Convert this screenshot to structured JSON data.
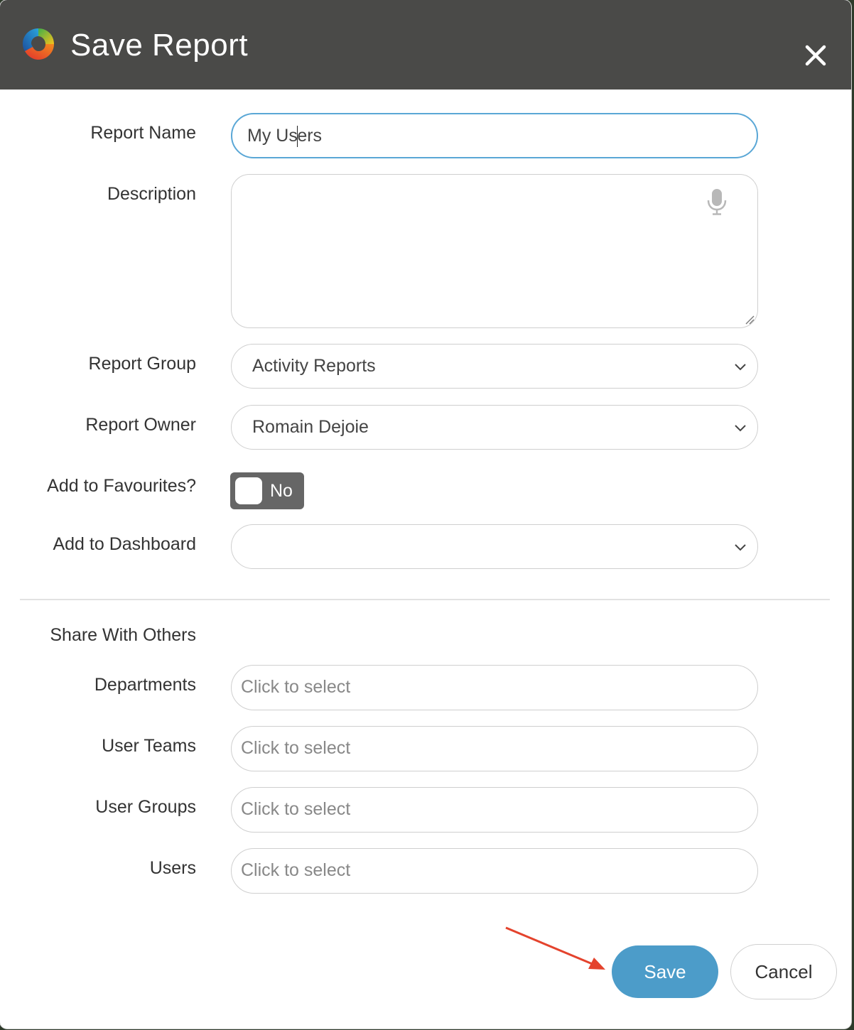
{
  "window": {
    "title": "Save Report",
    "close_icon": "close-icon",
    "logo_icon": "app-logo-icon"
  },
  "form": {
    "report_name": {
      "label": "Report Name",
      "value_before_caret": "My Us",
      "value_after_caret": "ers"
    },
    "description": {
      "label": "Description",
      "value": "",
      "icon": "microphone-icon"
    },
    "report_group": {
      "label": "Report Group",
      "value": "Activity Reports"
    },
    "report_owner": {
      "label": "Report Owner",
      "value": "Romain Dejoie"
    },
    "add_to_favourites": {
      "label": "Add to Favourites?",
      "toggle_text": "No",
      "checked": false
    },
    "add_to_dashboard": {
      "label": "Add to Dashboard",
      "value": ""
    }
  },
  "share": {
    "heading": "Share With Others",
    "departments": {
      "label": "Departments",
      "placeholder": "Click to select"
    },
    "user_teams": {
      "label": "User Teams",
      "placeholder": "Click to select"
    },
    "user_groups": {
      "label": "User Groups",
      "placeholder": "Click to select"
    },
    "users": {
      "label": "Users",
      "placeholder": "Click to select"
    }
  },
  "actions": {
    "save_label": "Save",
    "cancel_label": "Cancel"
  },
  "colors": {
    "titlebar": "#4a4a48",
    "save_button": "#4c9cc9",
    "focus_border": "#5aa7d6",
    "annotation_arrow": "#e4432d"
  }
}
